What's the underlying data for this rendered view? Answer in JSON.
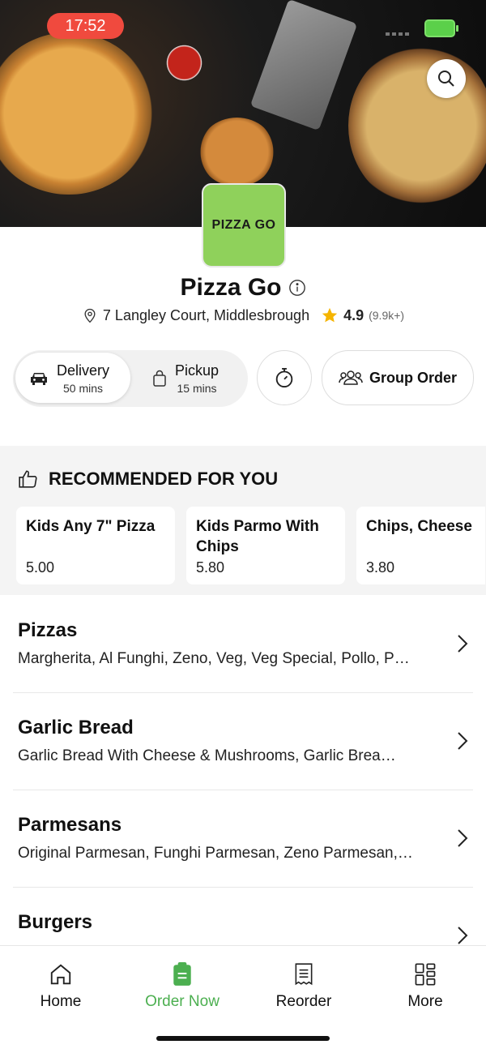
{
  "status": {
    "time": "17:52"
  },
  "restaurant": {
    "logo_text": "PIZZA GO",
    "name": "Pizza Go",
    "address": "7 Langley Court, Middlesbrough",
    "rating": "4.9",
    "rating_count": "(9.9k+)"
  },
  "order_mode": {
    "delivery": {
      "label": "Delivery",
      "time": "50 mins"
    },
    "pickup": {
      "label": "Pickup",
      "time": "15 mins"
    },
    "group_order": "Group Order"
  },
  "recommended": {
    "title": "RECOMMENDED FOR YOU",
    "items": [
      {
        "name": "Kids Any 7\" Pizza",
        "price": "5.00"
      },
      {
        "name": "Kids Parmo With Chips",
        "price": "5.80"
      },
      {
        "name": "Chips, Cheese & Any Sauce",
        "price": "3.80"
      }
    ]
  },
  "categories": [
    {
      "name": "Pizzas",
      "desc": "Margherita, Al Funghi, Zeno, Veg, Veg Special, Pollo, P…"
    },
    {
      "name": "Garlic Bread",
      "desc": "Garlic Bread With Cheese & Mushrooms, Garlic Brea…"
    },
    {
      "name": "Parmesans",
      "desc": "Original Parmesan, Funghi Parmesan, Zeno Parmesan,…"
    },
    {
      "name": "Burgers",
      "desc": ""
    }
  ],
  "tabs": {
    "home": "Home",
    "order_now": "Order Now",
    "reorder": "Reorder",
    "more": "More"
  },
  "colors": {
    "accent": "#4caf50",
    "logo_bg": "#8fd15b",
    "star": "#f5b400"
  }
}
